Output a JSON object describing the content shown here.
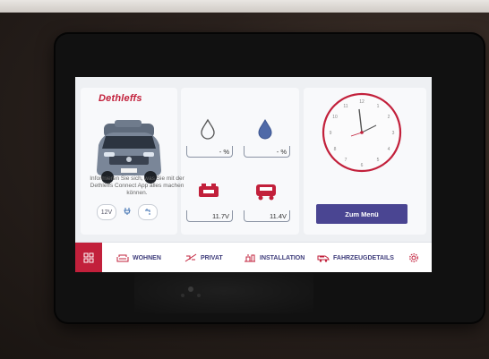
{
  "brand": {
    "name": "Dethleffs",
    "color": "#c2203b"
  },
  "left_panel": {
    "voltage_button": "12V",
    "icons": [
      "plug-icon",
      "tap-icon"
    ]
  },
  "tiles": {
    "fresh_water": {
      "icon": "water-drop-outline-icon",
      "value": "- %"
    },
    "grey_water": {
      "icon": "water-drop-filled-icon",
      "value": "- %"
    },
    "battery_living": {
      "icon": "battery-living-icon",
      "value": "11.7V"
    },
    "battery_starter": {
      "icon": "battery-starter-icon",
      "value": "11.4V"
    }
  },
  "clock": {
    "accent_color": "#c2203b",
    "info_text": "Informieren Sie sich, was Sie mit der Dethleffs Connect App alles machen können.",
    "menu_button": "Zum Menü"
  },
  "navbar": {
    "home_icon": "grid-icon",
    "items": [
      {
        "label": "WOHNEN",
        "icon": "sofa-icon"
      },
      {
        "label": "PRIVAT",
        "icon": "privacy-icon"
      },
      {
        "label": "INSTALLATION",
        "icon": "installation-icon"
      },
      {
        "label": "FAHRZEUGDETAILS",
        "icon": "vehicle-icon"
      }
    ],
    "settings_icon": "gear-icon",
    "accent_color": "#3d3b7a"
  }
}
